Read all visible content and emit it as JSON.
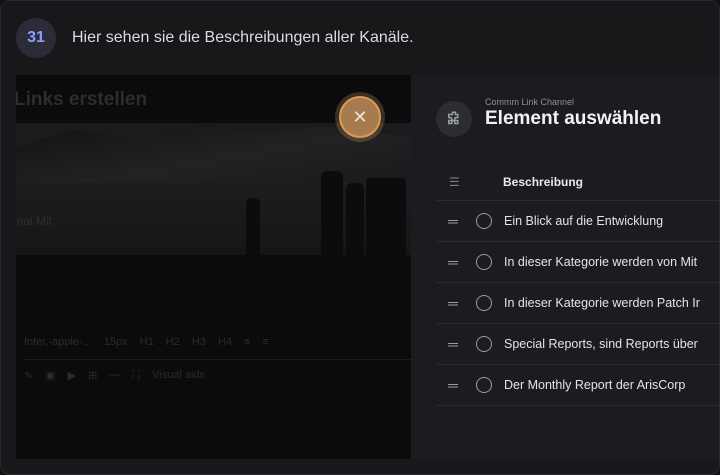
{
  "step": {
    "number": "31",
    "text": "Hier sehen sie die Beschreibungen aller Kanäle."
  },
  "background_editor": {
    "title": "Links erstellen",
    "subtitle": "inal Mit",
    "toolbar_items": [
      "Inter,-apple-...",
      "15px",
      "H1",
      "H2",
      "H3",
      "H4"
    ],
    "toolbar2_label": "Visual aids"
  },
  "close_button": {
    "icon": "close-icon",
    "color": "#a87a4f"
  },
  "panel": {
    "supertitle": "Commm Link Channel",
    "title": "Element auswählen",
    "icon": "puzzle-icon",
    "column_header": "Beschreibung",
    "rows": [
      "Ein Blick auf die Entwicklung",
      "In dieser Kategorie werden von Mit",
      "In dieser Kategorie werden Patch Ir",
      "Special Reports, sind Reports über",
      "Der Monthly Report der ArisCorp"
    ]
  },
  "colors": {
    "accent": "#8f9cff",
    "panel_bg": "#1b1c21",
    "page_bg": "#18181b"
  }
}
